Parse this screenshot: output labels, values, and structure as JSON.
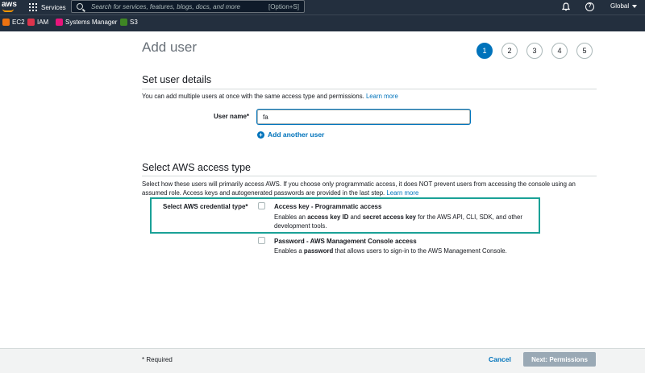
{
  "topbar": {
    "logo": "aws",
    "services_label": "Services",
    "search_placeholder": "Search for services, features, blogs, docs, and more",
    "search_shortcut": "[Option+S]",
    "help_glyph": "?",
    "region": "Global"
  },
  "favorites": [
    {
      "label": "EC2",
      "color": "#ec7211"
    },
    {
      "label": "IAM",
      "color": "#dd344c"
    },
    {
      "label": "Systems Manager",
      "color": "#e7157b"
    },
    {
      "label": "S3",
      "color": "#3f8624"
    }
  ],
  "page": {
    "title": "Add user",
    "steps": [
      "1",
      "2",
      "3",
      "4",
      "5"
    ],
    "active_step": "1"
  },
  "user_details": {
    "heading": "Set user details",
    "description": "You can add multiple users at once with the same access type and permissions.",
    "learn_more": "Learn more",
    "user_name_label": "User name*",
    "user_name_value": "fa",
    "add_another": "Add another user"
  },
  "access_type": {
    "heading": "Select AWS access type",
    "description": "Select how these users will primarily access AWS. If you choose only programmatic access, it does NOT prevent users from accessing the console using an assumed role. Access keys and autogenerated passwords are provided in the last step.",
    "learn_more": "Learn more",
    "credential_label": "Select AWS credential type*",
    "options": [
      {
        "title": "Access key - Programmatic access",
        "desc_pre": "Enables an ",
        "desc_b1": "access key ID",
        "desc_mid": " and ",
        "desc_b2": "secret access key",
        "desc_post": " for the AWS API, CLI, SDK, and other development tools."
      },
      {
        "title": "Password - AWS Management Console access",
        "desc_pre": "Enables a ",
        "desc_b1": "password",
        "desc_post": " that allows users to sign-in to the AWS Management Console."
      }
    ]
  },
  "footer": {
    "required": "* Required",
    "cancel": "Cancel",
    "next": "Next: Permissions"
  },
  "colors": {
    "nav": "#232f3e",
    "accent": "#0073bb",
    "highlight": "#1aa197"
  }
}
